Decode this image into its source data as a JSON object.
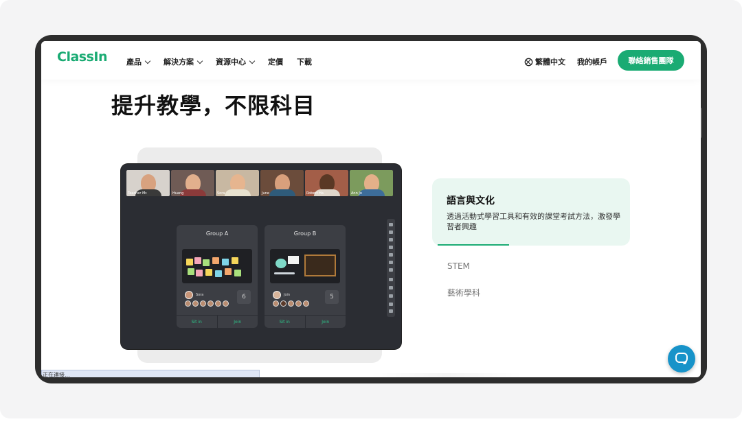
{
  "nav": {
    "logo": "ClassIn",
    "items": [
      {
        "label": "產品",
        "has_dropdown": true
      },
      {
        "label": "解決方案",
        "has_dropdown": true
      },
      {
        "label": "資源中心",
        "has_dropdown": true
      },
      {
        "label": "定價",
        "has_dropdown": false
      },
      {
        "label": "下載",
        "has_dropdown": false
      }
    ],
    "language": "繁體中文",
    "account": "我的帳戶",
    "cta": "聯絡銷售團隊"
  },
  "headline": "提升教學，不限科目",
  "demo": {
    "videos": [
      {
        "label": "Teacher Mr.",
        "shirt": "#3a3a3a",
        "bg": "#d7d2cc"
      },
      {
        "label": "Huang",
        "shirt": "#8b3a3a",
        "bg": "#6f5b55"
      },
      {
        "label": "Sora",
        "shirt": "#e8e2d0",
        "bg": "#c8b8a2"
      },
      {
        "label": "June",
        "shirt": "#2f5b7a",
        "bg": "#6b4c3b"
      },
      {
        "label": "Robert Ha",
        "shirt": "#e0d7cb",
        "bg": "#a35e48"
      },
      {
        "label": "Ann Jo",
        "shirt": "#3d6d9a",
        "bg": "#7c9b5d"
      }
    ],
    "groups": [
      {
        "title": "Group A",
        "member": "Sora",
        "count": "6",
        "sit_in": "Sit in",
        "join": "Join"
      },
      {
        "title": "Group B",
        "member": "Join",
        "count": "5",
        "sit_in": "Sit in",
        "join": "Join"
      }
    ]
  },
  "features": {
    "active": {
      "title": "語言與文化",
      "description": "透過活動式學習工具和有效的課堂考試方法，激發學習者興趣"
    },
    "items": [
      "STEM",
      "藝術學科"
    ]
  },
  "status_bar": "正在連接...",
  "colors": {
    "brand": "#1aab73",
    "active_card": "#e9f7f1",
    "chat": "#1793c9"
  }
}
